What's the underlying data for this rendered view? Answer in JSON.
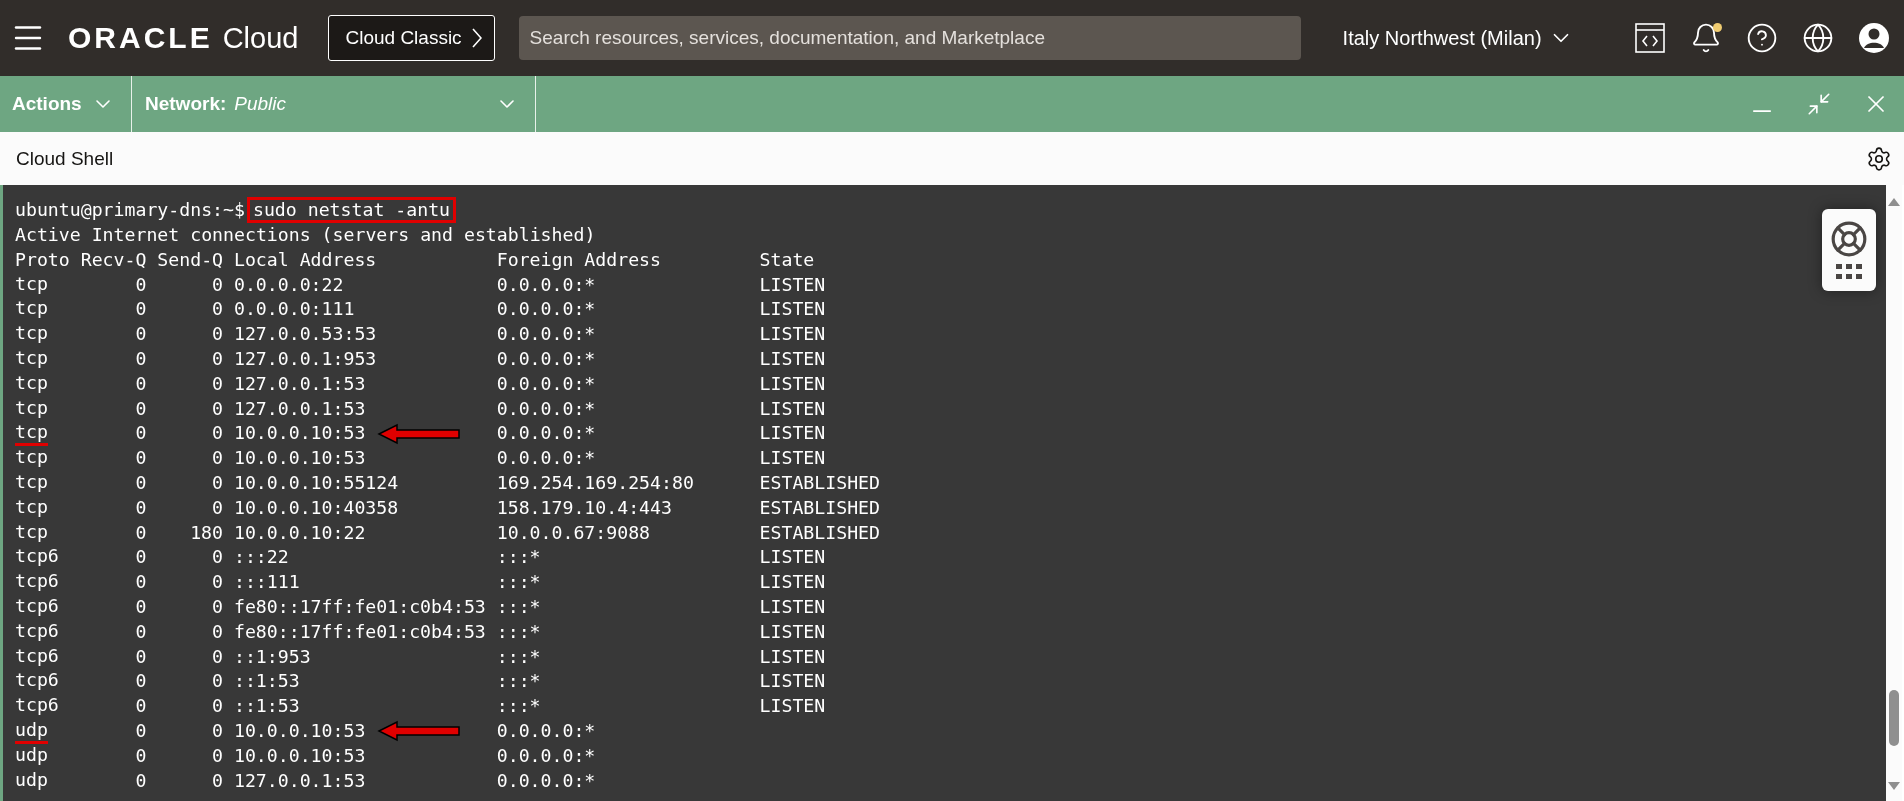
{
  "top_bar": {
    "brand": "ORACLE",
    "product": "Cloud",
    "classic_button": "Cloud Classic",
    "search": {
      "placeholder": "Search resources, services, documentation, and Marketplace"
    },
    "region": "Italy Northwest (Milan)",
    "notification_unread": true
  },
  "shell_toolbar": {
    "actions_menu": "Actions",
    "network_menu": {
      "label": "Network:",
      "value": "Public"
    }
  },
  "panel_title": "Cloud Shell",
  "terminal": {
    "prompt": "ubuntu@primary-dns:~$",
    "command": "sudo netstat -antu",
    "command_highlighted": true,
    "output_line": "Active Internet connections (servers and established)",
    "columns": [
      "Proto",
      "Recv-Q",
      "Send-Q",
      "Local Address",
      "Foreign Address",
      "State"
    ],
    "rows": [
      {
        "proto": "tcp",
        "recv_q": "0",
        "send_q": "0",
        "local": "0.0.0.0:22",
        "foreign": "0.0.0.0:*",
        "state": "LISTEN",
        "marked": false
      },
      {
        "proto": "tcp",
        "recv_q": "0",
        "send_q": "0",
        "local": "0.0.0.0:111",
        "foreign": "0.0.0.0:*",
        "state": "LISTEN",
        "marked": false
      },
      {
        "proto": "tcp",
        "recv_q": "0",
        "send_q": "0",
        "local": "127.0.0.53:53",
        "foreign": "0.0.0.0:*",
        "state": "LISTEN",
        "marked": false
      },
      {
        "proto": "tcp",
        "recv_q": "0",
        "send_q": "0",
        "local": "127.0.0.1:953",
        "foreign": "0.0.0.0:*",
        "state": "LISTEN",
        "marked": false
      },
      {
        "proto": "tcp",
        "recv_q": "0",
        "send_q": "0",
        "local": "127.0.0.1:53",
        "foreign": "0.0.0.0:*",
        "state": "LISTEN",
        "marked": false
      },
      {
        "proto": "tcp",
        "recv_q": "0",
        "send_q": "0",
        "local": "127.0.0.1:53",
        "foreign": "0.0.0.0:*",
        "state": "LISTEN",
        "marked": false
      },
      {
        "proto": "tcp",
        "recv_q": "0",
        "send_q": "0",
        "local": "10.0.0.10:53",
        "foreign": "0.0.0.0:*",
        "state": "LISTEN",
        "marked": true
      },
      {
        "proto": "tcp",
        "recv_q": "0",
        "send_q": "0",
        "local": "10.0.0.10:53",
        "foreign": "0.0.0.0:*",
        "state": "LISTEN",
        "marked": false
      },
      {
        "proto": "tcp",
        "recv_q": "0",
        "send_q": "0",
        "local": "10.0.0.10:55124",
        "foreign": "169.254.169.254:80",
        "state": "ESTABLISHED",
        "marked": false
      },
      {
        "proto": "tcp",
        "recv_q": "0",
        "send_q": "0",
        "local": "10.0.0.10:40358",
        "foreign": "158.179.10.4:443",
        "state": "ESTABLISHED",
        "marked": false
      },
      {
        "proto": "tcp",
        "recv_q": "0",
        "send_q": "180",
        "local": "10.0.0.10:22",
        "foreign": "10.0.0.67:9088",
        "state": "ESTABLISHED",
        "marked": false
      },
      {
        "proto": "tcp6",
        "recv_q": "0",
        "send_q": "0",
        "local": ":::22",
        "foreign": ":::*",
        "state": "LISTEN",
        "marked": false
      },
      {
        "proto": "tcp6",
        "recv_q": "0",
        "send_q": "0",
        "local": ":::111",
        "foreign": ":::*",
        "state": "LISTEN",
        "marked": false
      },
      {
        "proto": "tcp6",
        "recv_q": "0",
        "send_q": "0",
        "local": "fe80::17ff:fe01:c0b4:53",
        "foreign": ":::*",
        "state": "LISTEN",
        "marked": false
      },
      {
        "proto": "tcp6",
        "recv_q": "0",
        "send_q": "0",
        "local": "fe80::17ff:fe01:c0b4:53",
        "foreign": ":::*",
        "state": "LISTEN",
        "marked": false
      },
      {
        "proto": "tcp6",
        "recv_q": "0",
        "send_q": "0",
        "local": "::1:953",
        "foreign": ":::*",
        "state": "LISTEN",
        "marked": false
      },
      {
        "proto": "tcp6",
        "recv_q": "0",
        "send_q": "0",
        "local": "::1:53",
        "foreign": ":::*",
        "state": "LISTEN",
        "marked": false
      },
      {
        "proto": "tcp6",
        "recv_q": "0",
        "send_q": "0",
        "local": "::1:53",
        "foreign": ":::*",
        "state": "LISTEN",
        "marked": false
      },
      {
        "proto": "udp",
        "recv_q": "0",
        "send_q": "0",
        "local": "10.0.0.10:53",
        "foreign": "0.0.0.0:*",
        "marked": true
      },
      {
        "proto": "udp",
        "recv_q": "0",
        "send_q": "0",
        "local": "10.0.0.10:53",
        "foreign": "0.0.0.0:*",
        "marked": false
      },
      {
        "proto": "udp",
        "recv_q": "0",
        "send_q": "0",
        "local": "127.0.0.1:53",
        "foreign": "0.0.0.0:*",
        "marked": false
      }
    ]
  }
}
